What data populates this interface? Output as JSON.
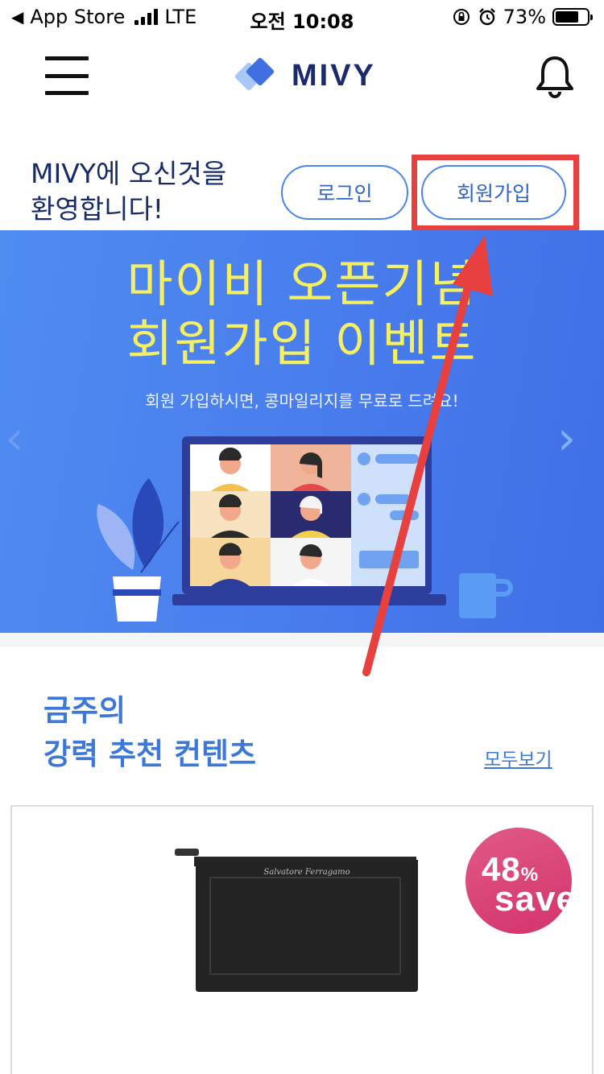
{
  "status_bar": {
    "back_app": "App Store",
    "network": "LTE",
    "time": "오전 10:08",
    "battery_percent": "73%",
    "battery_level": 0.73
  },
  "header": {
    "menu_icon": "hamburger-icon",
    "logo_text": "MIVY",
    "notification_icon": "bell-icon"
  },
  "welcome": {
    "line1": "MIVY에 오신것을",
    "line2": "환영합니다!",
    "login_label": "로그인",
    "signup_label": "회원가입"
  },
  "banner": {
    "title_line1": "마이비 오픈기념",
    "title_line2": "회원가입 이벤트",
    "subtitle": "회원 가입하시면, 콩마일리지를 무료로 드려요!",
    "prev_icon": "chevron-left-icon",
    "next_icon": "chevron-right-icon"
  },
  "recommend": {
    "title_line1": "금주의",
    "title_line2": "강력 추천 컨텐츠",
    "see_all": "모두보기",
    "product": {
      "brand_mark": "Salvatore Ferragamo",
      "discount": "48",
      "discount_unit": "%",
      "discount_word": "save"
    }
  },
  "colors": {
    "brand_navy": "#172b6a",
    "accent_blue": "#3c78d8",
    "banner_yellow": "#f5ef62",
    "highlight_red": "#e8403f",
    "badge_pink": "#d4336c"
  }
}
